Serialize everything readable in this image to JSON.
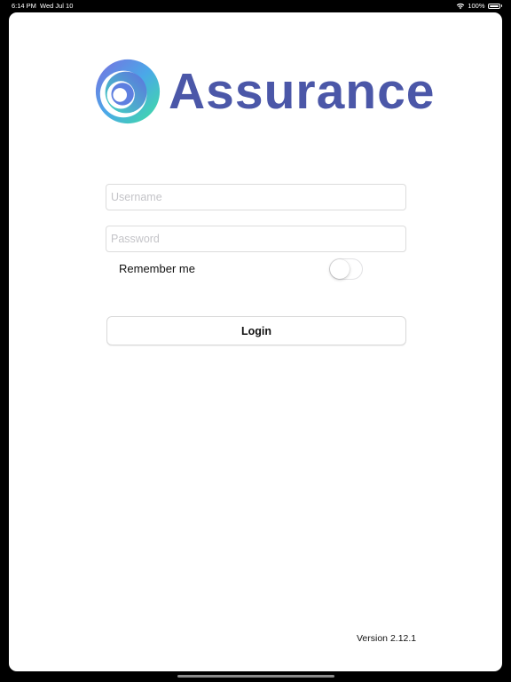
{
  "status_bar": {
    "time": "6:14 PM",
    "date": "Wed Jul 10",
    "battery_percent": "100%"
  },
  "app": {
    "logo_text": "Assurance",
    "brand_color": "#4b57a8",
    "accent_gradient": [
      "#6b6fd8",
      "#3ecfcf",
      "#3fe0a0"
    ]
  },
  "form": {
    "username": {
      "value": "",
      "placeholder": "Username"
    },
    "password": {
      "value": "",
      "placeholder": "Password"
    },
    "remember_label": "Remember me",
    "remember_on": false,
    "login_label": "Login"
  },
  "footer": {
    "version": "Version 2.12.1"
  }
}
